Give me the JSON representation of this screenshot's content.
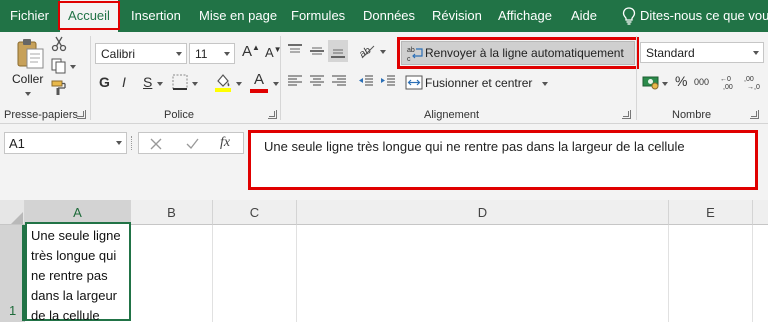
{
  "menu": {
    "tabs": [
      {
        "label": "Fichier"
      },
      {
        "label": "Accueil"
      },
      {
        "label": "Insertion"
      },
      {
        "label": "Mise en page"
      },
      {
        "label": "Formules"
      },
      {
        "label": "Données"
      },
      {
        "label": "Révision"
      },
      {
        "label": "Affichage"
      },
      {
        "label": "Aide"
      }
    ],
    "tell_me": "Dites-nous ce que vous v",
    "active_tab": "Accueil",
    "highlight_color": "#e00000"
  },
  "ribbon": {
    "clipboard": {
      "paste_label": "Coller",
      "group_label": "Presse-papiers"
    },
    "font": {
      "family": "Calibri",
      "size": "11",
      "grow": "A",
      "shrink": "A",
      "bold": "G",
      "italic": "I",
      "underline": "S",
      "font_color_letter": "A",
      "group_label": "Police"
    },
    "alignment": {
      "wrap_label": "Renvoyer à la ligne automatiquement",
      "merge_label": "Fusionner et centrer",
      "group_label": "Alignement"
    },
    "number": {
      "format": "Standard",
      "percent": "%",
      "thousands": "000",
      "group_label": "Nombre"
    }
  },
  "formula_bar": {
    "name_box": "A1",
    "fx": "fx",
    "content": "Une seule ligne très longue qui ne rentre pas dans la largeur de la cellule"
  },
  "sheet": {
    "columns": [
      "A",
      "B",
      "C",
      "D",
      "E"
    ],
    "rows": [
      "1"
    ],
    "selected_column": "A",
    "cell_a1": "Une seule ligne très longue qui ne rentre pas dans la largeur de la cellule"
  },
  "colors": {
    "excel_green": "#217346",
    "ribbon_bg": "#f3f3f3",
    "highlight_red": "#e00000",
    "fill_yellow": "#ffff00",
    "font_red": "#e00000"
  }
}
